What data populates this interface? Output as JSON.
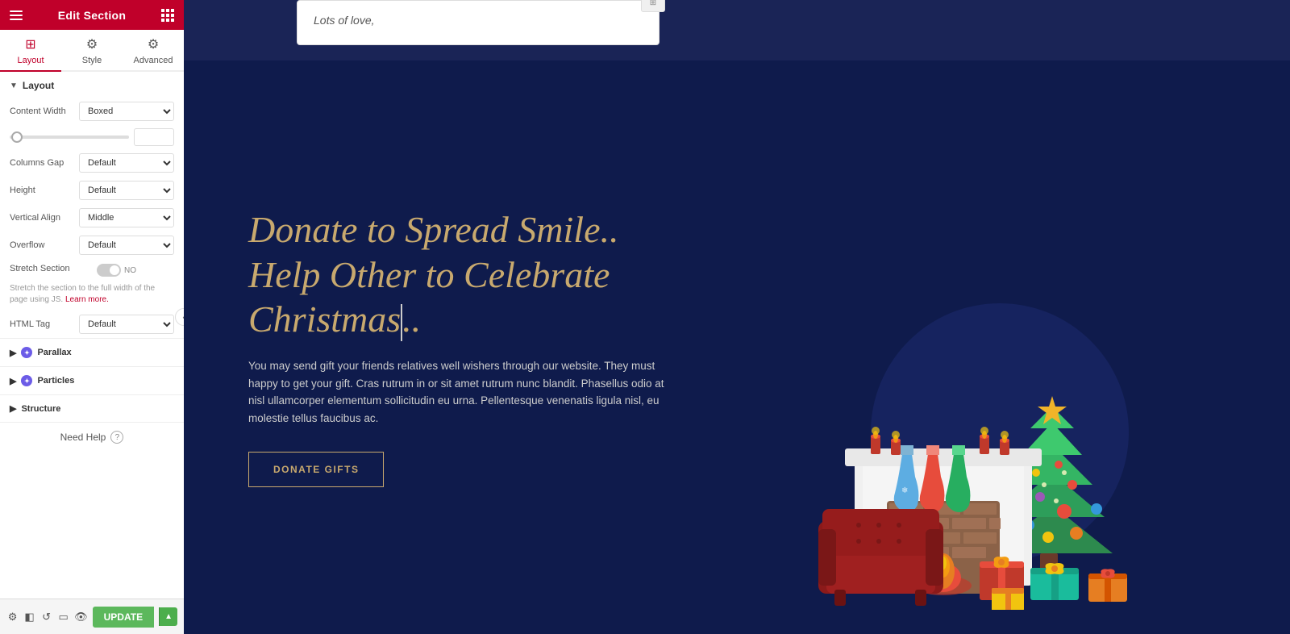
{
  "header": {
    "title": "Edit Section",
    "menu_icon": "hamburger",
    "apps_icon": "grid"
  },
  "tabs": [
    {
      "id": "layout",
      "label": "Layout",
      "icon": "⊞",
      "active": true
    },
    {
      "id": "style",
      "label": "Style",
      "icon": "⚙",
      "active": false
    },
    {
      "id": "advanced",
      "label": "Advanced",
      "icon": "⚙",
      "active": false
    }
  ],
  "layout_section": {
    "label": "Layout",
    "fields": {
      "content_width": {
        "label": "Content Width",
        "value": "Boxed"
      },
      "columns_gap": {
        "label": "Columns Gap",
        "value": "Default"
      },
      "height": {
        "label": "Height",
        "value": "Default"
      },
      "vertical_align": {
        "label": "Vertical Align",
        "value": "Middle"
      },
      "overflow": {
        "label": "Overflow",
        "value": "Default"
      },
      "stretch_section": {
        "label": "Stretch Section",
        "value": "NO"
      },
      "stretch_help": "Stretch the section to the full width of the page using JS.",
      "learn_more": "Learn more.",
      "html_tag": {
        "label": "HTML Tag",
        "value": "Default"
      }
    }
  },
  "parallax": {
    "label": "Parallax"
  },
  "particles": {
    "label": "Particles"
  },
  "structure": {
    "label": "Structure"
  },
  "footer": {
    "need_help": "Need Help"
  },
  "toolbar": {
    "update_label": "UPDATE",
    "icons": [
      "settings",
      "layers",
      "history",
      "mobile",
      "eye"
    ]
  },
  "canvas": {
    "top_card": {
      "text": "Lots of love,"
    },
    "main": {
      "title_line1": "Donate to Spread Smile..",
      "title_line2": "Help Other to Celebrate Christmas..",
      "body_text": "You may send gift your friends relatives well wishers through our website. They must happy to get your gift. Cras rutrum in or sit amet rutrum nunc blandit. Phasellus odio at nisl ullamcorper elementum sollicitudin eu urna. Pellentesque venenatis ligula nisl, eu molestie tellus faucibus ac.",
      "button_label": "DONATE GIFTS"
    }
  }
}
